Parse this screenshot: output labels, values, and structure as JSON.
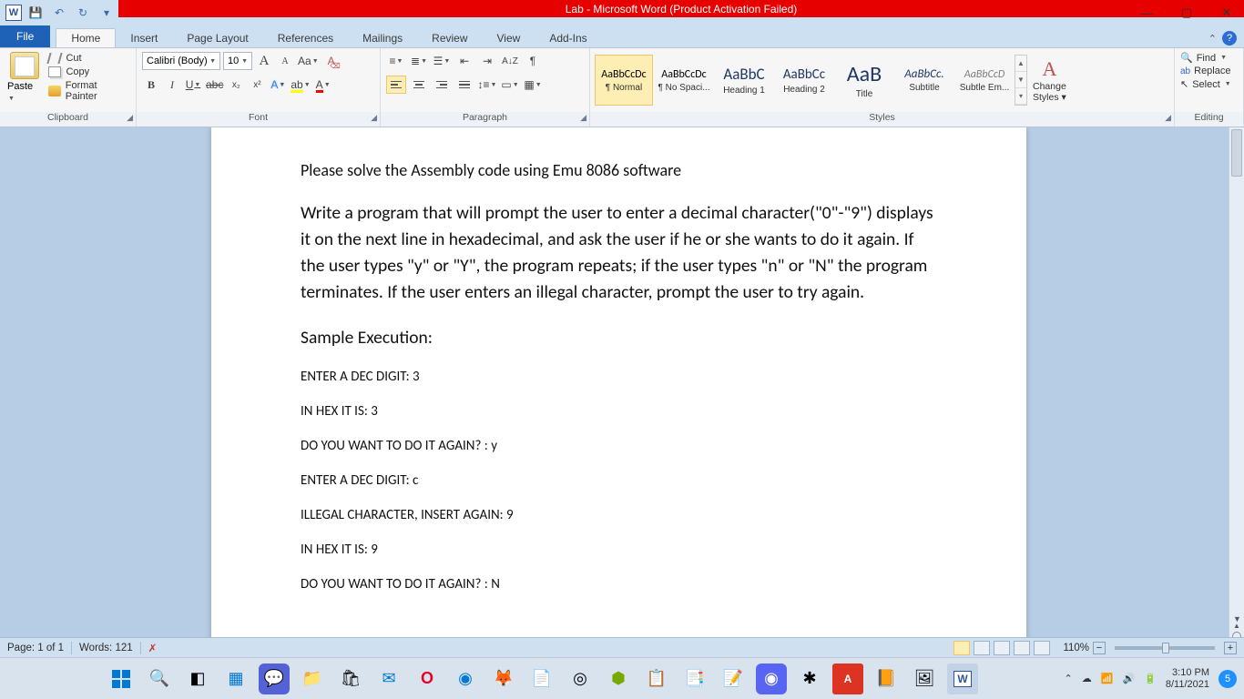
{
  "window": {
    "title": "Lab  -  Microsoft Word (Product Activation Failed)"
  },
  "qat": {
    "save": "💾",
    "undo": "↶",
    "redo": "↻"
  },
  "tabs": {
    "file": "File",
    "home": "Home",
    "insert": "Insert",
    "page_layout": "Page Layout",
    "references": "References",
    "mailings": "Mailings",
    "review": "Review",
    "view": "View",
    "addins": "Add-Ins"
  },
  "clipboard": {
    "paste": "Paste",
    "cut": "Cut",
    "copy": "Copy",
    "format_painter": "Format Painter",
    "label": "Clipboard"
  },
  "font": {
    "name": "Calibri (Body)",
    "size": "10",
    "label": "Font",
    "grow": "A",
    "shrink": "A",
    "case": "Aa",
    "clear": "A",
    "bold": "B",
    "italic": "I",
    "underline": "U",
    "strike": "abc",
    "sub": "x₂",
    "sup": "x²",
    "effects": "A",
    "highlight": "ab",
    "color": "A"
  },
  "paragraph": {
    "label": "Paragraph",
    "sort": "A↓Z",
    "pilcrow": "¶",
    "shading": "▭",
    "border": "▦"
  },
  "styles": {
    "label": "Styles",
    "items": [
      {
        "preview": "AaBbCcDc",
        "name": "¶ Normal",
        "sel": true,
        "fs": "12px",
        "col": "#000"
      },
      {
        "preview": "AaBbCcDc",
        "name": "¶ No Spaci...",
        "fs": "12px",
        "col": "#000"
      },
      {
        "preview": "AaBbC",
        "name": "Heading 1",
        "fs": "17px",
        "col": "#1f3864"
      },
      {
        "preview": "AaBbCc",
        "name": "Heading 2",
        "fs": "15px",
        "col": "#1f3864"
      },
      {
        "preview": "AaB",
        "name": "Title",
        "fs": "24px",
        "col": "#1f3864"
      },
      {
        "preview": "AaBbCc.",
        "name": "Subtitle",
        "fs": "13px",
        "it": true,
        "col": "#1f3864"
      },
      {
        "preview": "AaBbCcD",
        "name": "Subtle Em...",
        "fs": "12px",
        "it": true,
        "col": "#7f7f7f"
      }
    ],
    "change": "Change Styles"
  },
  "editing": {
    "find": "Find",
    "replace": "Replace",
    "select": "Select",
    "label": "Editing"
  },
  "document": {
    "p1": "Please solve the Assembly code using Emu 8086 software",
    "p2": "Write a program that will prompt the user to enter a decimal character(\"0\"-\"9\") displays it on the next line in hexadecimal, and ask the user if he or she wants to do it again. If the user types \"y\" or \"Y\", the program repeats; if the user types \"n\" or \"N\" the program terminates. If the user enters an illegal character, prompt the user to try again.",
    "p3": "Sample Execution:",
    "s1": "ENTER A DEC DIGIT: 3",
    "s2": "IN HEX IT IS: 3",
    "s3": "DO YOU WANT TO DO IT AGAIN? : y",
    "s4": "ENTER A DEC DIGIT: c",
    "s5": "ILLEGAL CHARACTER, INSERT AGAIN: 9",
    "s6": "IN HEX IT IS: 9",
    "s7": "DO YOU WANT TO DO IT AGAIN? : N"
  },
  "status": {
    "page": "Page: 1 of 1",
    "words": "Words: 121",
    "zoom": "110%"
  },
  "taskbar": {
    "time": "3:10 PM",
    "date": "8/11/2021",
    "badge": "5"
  }
}
